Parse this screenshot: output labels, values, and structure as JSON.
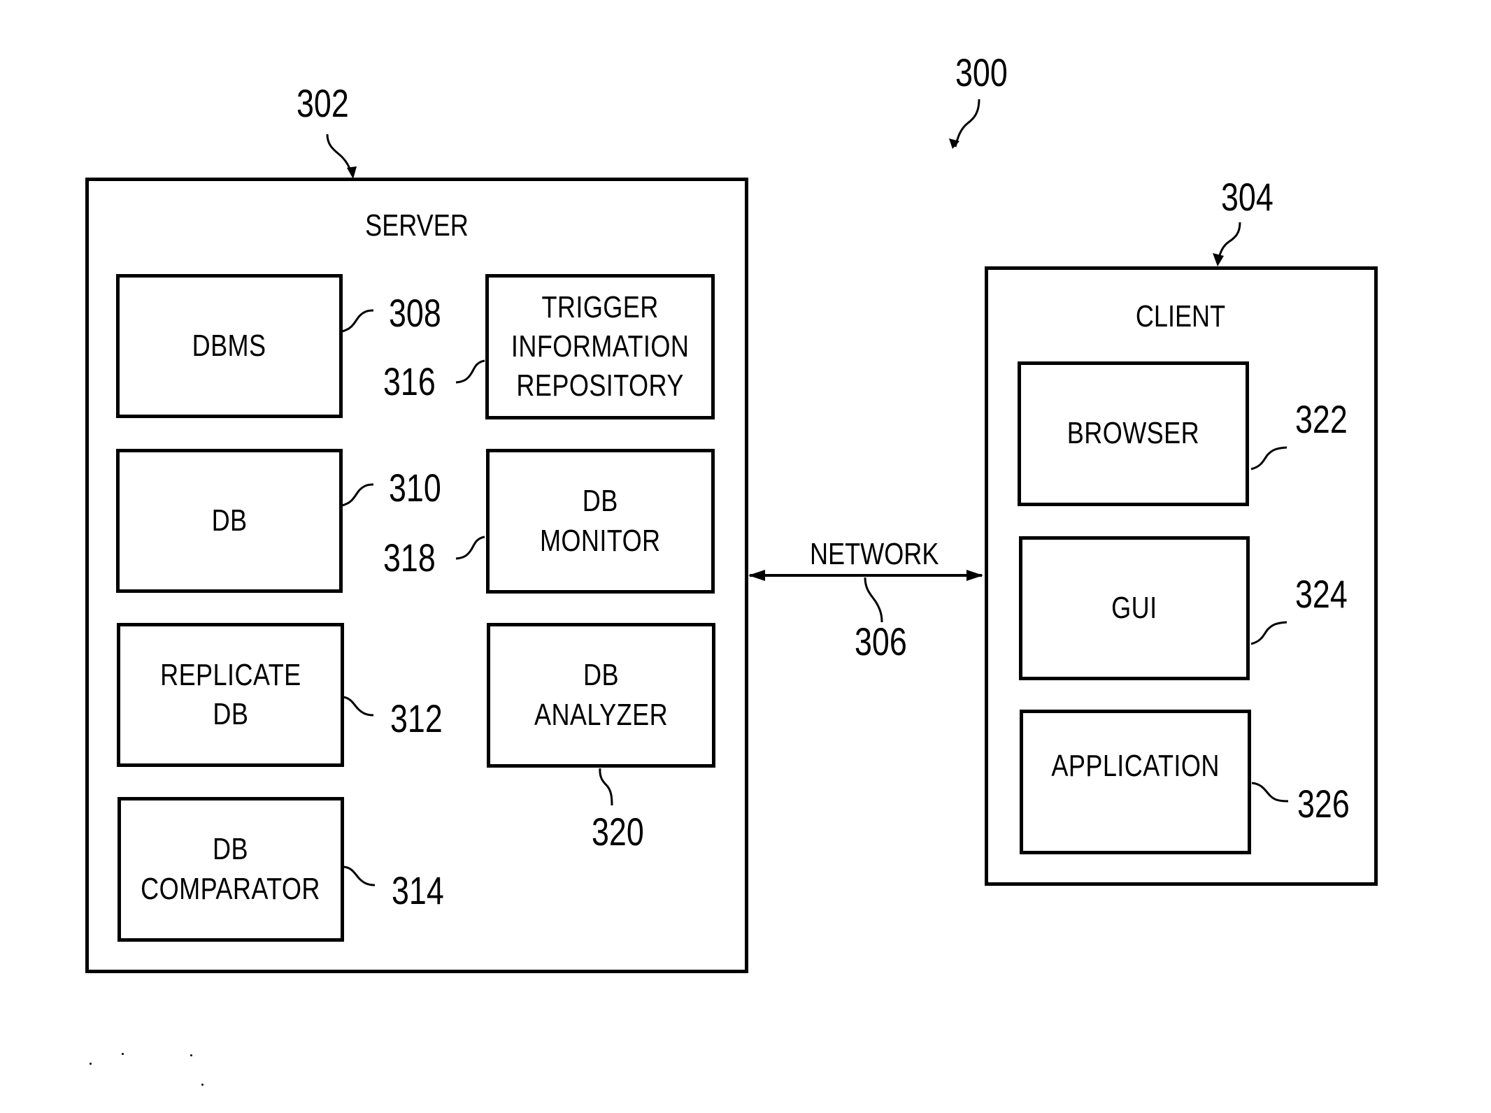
{
  "figure": {
    "system_ref": "300",
    "network": {
      "label": "NETWORK",
      "ref": "306"
    },
    "server": {
      "title": "SERVER",
      "ref": "302",
      "components": [
        {
          "id": "dbms",
          "label": "DBMS",
          "ref": "308"
        },
        {
          "id": "db",
          "label": "DB",
          "ref": "310"
        },
        {
          "id": "replicate-db",
          "label": "REPLICATE\nDB",
          "ref": "312"
        },
        {
          "id": "db-comparator",
          "label": "DB\nCOMPARATOR",
          "ref": "314"
        },
        {
          "id": "trigger-information-repository",
          "label": "TRIGGER\nINFORMATION\nREPOSITORY",
          "ref": "316"
        },
        {
          "id": "db-monitor",
          "label": "DB\nMONITOR",
          "ref": "318"
        },
        {
          "id": "db-analyzer",
          "label": "DB\nANALYZER",
          "ref": "320"
        }
      ]
    },
    "client": {
      "title": "CLIENT",
      "ref": "304",
      "components": [
        {
          "id": "browser",
          "label": "BROWSER",
          "ref": "322"
        },
        {
          "id": "gui",
          "label": "GUI",
          "ref": "324"
        },
        {
          "id": "application",
          "label": "APPLICATION",
          "ref": "326"
        }
      ]
    }
  }
}
